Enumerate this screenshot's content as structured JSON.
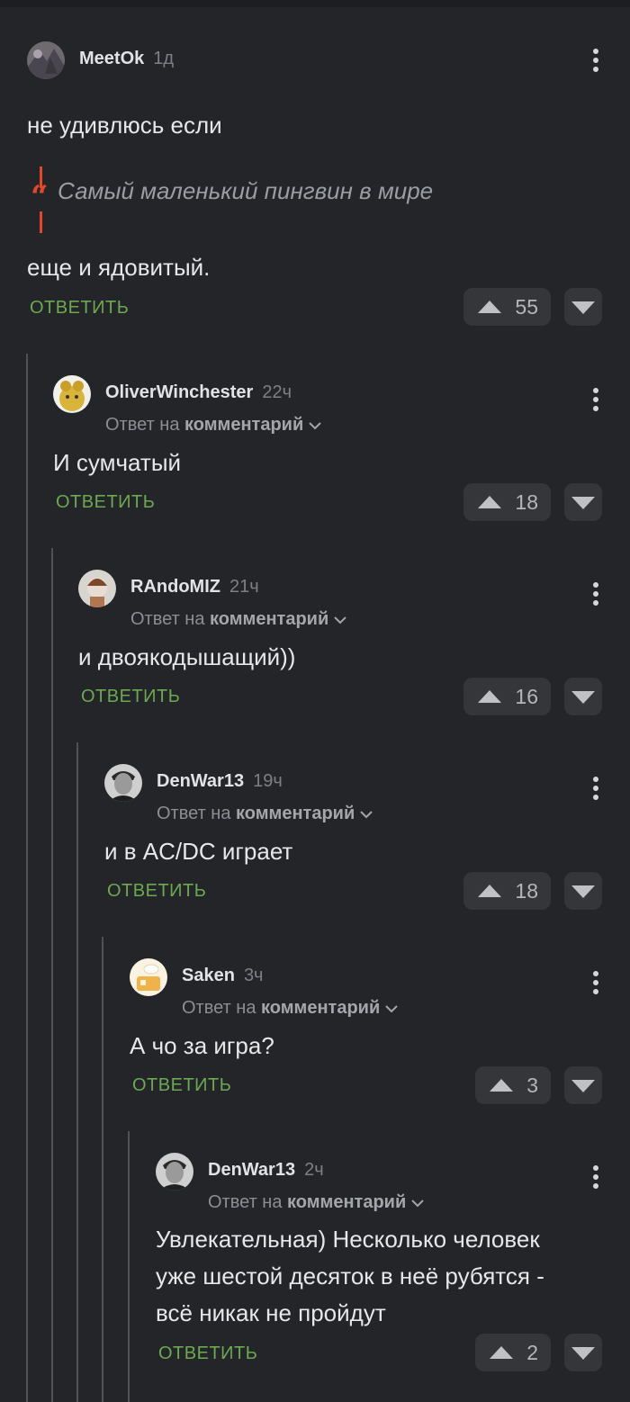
{
  "common": {
    "reply_label": "ОТВЕТИТЬ",
    "reply_to_prefix": "Ответ на",
    "reply_to_link": "комментарий"
  },
  "comments": [
    {
      "username": "MeetOk",
      "time": "1д",
      "text_before": "не удивлюсь если",
      "quote": "Самый маленький пингвин в мире",
      "text_after": "еще и ядовитый.",
      "score": "55"
    },
    {
      "username": "OliverWinchester",
      "time": "22ч",
      "text": "И сумчатый",
      "score": "18"
    },
    {
      "username": "RAndoMIZ",
      "time": "21ч",
      "text": "и двоякодышащий))",
      "score": "16"
    },
    {
      "username": "DenWar13",
      "time": "19ч",
      "text": "и в AC/DC играет",
      "score": "18"
    },
    {
      "username": "Saken",
      "time": "3ч",
      "text": "А чо за игра?",
      "score": "3"
    },
    {
      "username": "DenWar13",
      "time": "2ч",
      "text_lines": [
        "Увлекательная) Несколько человек",
        "уже шестой десяток в неё рубятся -",
        "всё никак не пройдут"
      ],
      "score": "2"
    }
  ],
  "colors": {
    "background": "#232528",
    "reply_green": "#6da852",
    "quote_accent": "#e04a2a",
    "thread_line": "#505257"
  }
}
